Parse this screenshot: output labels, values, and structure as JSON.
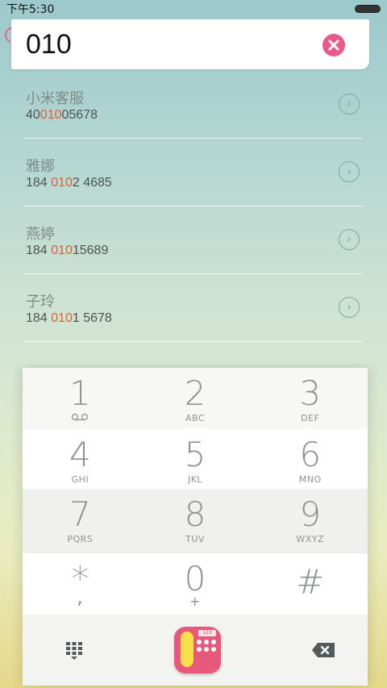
{
  "status": {
    "time": "下午5:30"
  },
  "search": {
    "value": "010"
  },
  "contacts": [
    {
      "name": "小米客服",
      "number_pre": "40",
      "number_hl": "010",
      "number_post": "05678"
    },
    {
      "name": "雅娜",
      "number_pre": "184 ",
      "number_hl": "010",
      "number_post": "2 4685"
    },
    {
      "name": "燕婷",
      "number_pre": "184 ",
      "number_hl": "010",
      "number_post": "15689"
    },
    {
      "name": "子玲",
      "number_pre": "184 ",
      "number_hl": "010",
      "number_post": "1 5678"
    }
  ],
  "keypad": {
    "k1": {
      "digit": "1",
      "letters": ""
    },
    "k2": {
      "digit": "2",
      "letters": "ABC"
    },
    "k3": {
      "digit": "3",
      "letters": "DEF"
    },
    "k4": {
      "digit": "4",
      "letters": "GHI"
    },
    "k5": {
      "digit": "5",
      "letters": "JKL"
    },
    "k6": {
      "digit": "6",
      "letters": "MNO"
    },
    "k7": {
      "digit": "7",
      "letters": "PQRS"
    },
    "k8": {
      "digit": "8",
      "letters": "TUV"
    },
    "k9": {
      "digit": "9",
      "letters": "WXYZ"
    },
    "kstar": {
      "digit": "*",
      "letters": ","
    },
    "k0": {
      "digit": "0",
      "letters": "+"
    },
    "khash": {
      "digit": "#",
      "letters": ""
    }
  },
  "dial_display": "123",
  "colors": {
    "accent": "#e85a87",
    "highlight": "#e0612e",
    "dial_yellow": "#f7e04a"
  },
  "icons": [
    "paperclip-icon",
    "clear-icon",
    "chevron-right-icon",
    "voicemail-icon",
    "keypad-toggle-icon",
    "dial-icon",
    "backspace-icon"
  ]
}
